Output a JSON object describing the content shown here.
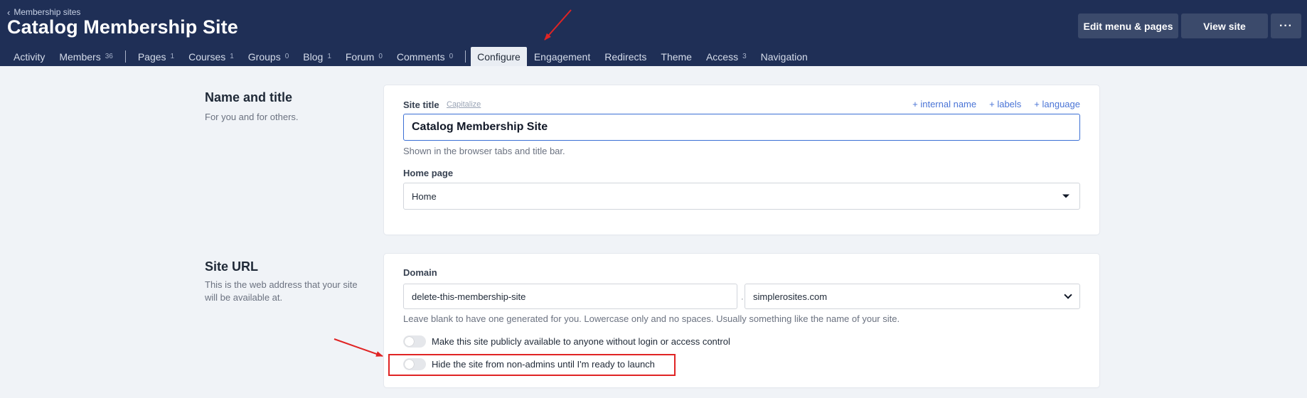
{
  "header": {
    "breadcrumb": "Membership sites",
    "title": "Catalog Membership Site",
    "buttons": {
      "edit": "Edit menu & pages",
      "view": "View site",
      "more": "···"
    }
  },
  "tabs": [
    {
      "label": "Activity"
    },
    {
      "label": "Members",
      "count": "36"
    },
    {
      "label": "Pages",
      "count": "1"
    },
    {
      "label": "Courses",
      "count": "1"
    },
    {
      "label": "Groups",
      "count": "0"
    },
    {
      "label": "Blog",
      "count": "1"
    },
    {
      "label": "Forum",
      "count": "0"
    },
    {
      "label": "Comments",
      "count": "0"
    },
    {
      "label": "Configure"
    },
    {
      "label": "Engagement"
    },
    {
      "label": "Redirects"
    },
    {
      "label": "Theme"
    },
    {
      "label": "Access",
      "count": "3"
    },
    {
      "label": "Navigation"
    }
  ],
  "name_section": {
    "title": "Name and title",
    "description": "For you and for others.",
    "site_title_label": "Site title",
    "capitalize": "Capitalize",
    "links": [
      "+ internal name",
      "+ labels",
      "+ language"
    ],
    "site_title_value": "Catalog Membership Site",
    "site_title_hint": "Shown in the browser tabs and title bar.",
    "home_page_label": "Home page",
    "home_page_value": "Home"
  },
  "url_section": {
    "title": "Site URL",
    "description": "This is the web address that your site will be available at.",
    "domain_label": "Domain",
    "subdomain_value": "delete-this-membership-site",
    "separator": "·",
    "domain_value": "simplerosites.com",
    "domain_hint": "Leave blank to have one generated for you. Lowercase only and no spaces. Usually something like the name of your site.",
    "toggle_public": "Make this site publicly available to anyone without login or access control",
    "toggle_hide": "Hide the site from non-admins until I'm ready to launch"
  },
  "colors": {
    "header_bg": "#1f2f56",
    "accent": "#3b6fd4",
    "annotation": "#e02424"
  }
}
